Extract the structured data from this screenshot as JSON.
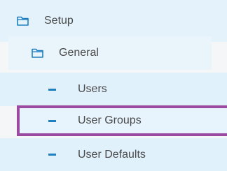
{
  "tree": {
    "setup": {
      "label": "Setup",
      "icon": "folder-icon"
    },
    "general": {
      "label": "General",
      "icon": "folder-icon"
    },
    "items": [
      {
        "label": "Users",
        "icon": "dash-icon"
      },
      {
        "label": "User Groups",
        "icon": "dash-icon",
        "highlighted": true
      },
      {
        "label": "User Defaults",
        "icon": "dash-icon"
      }
    ]
  },
  "colors": {
    "row_bg": "#e1f1fc",
    "icon_blue": "#1f7fbf",
    "highlight_border": "#9b4aa1",
    "text": "#4a4a4a"
  }
}
